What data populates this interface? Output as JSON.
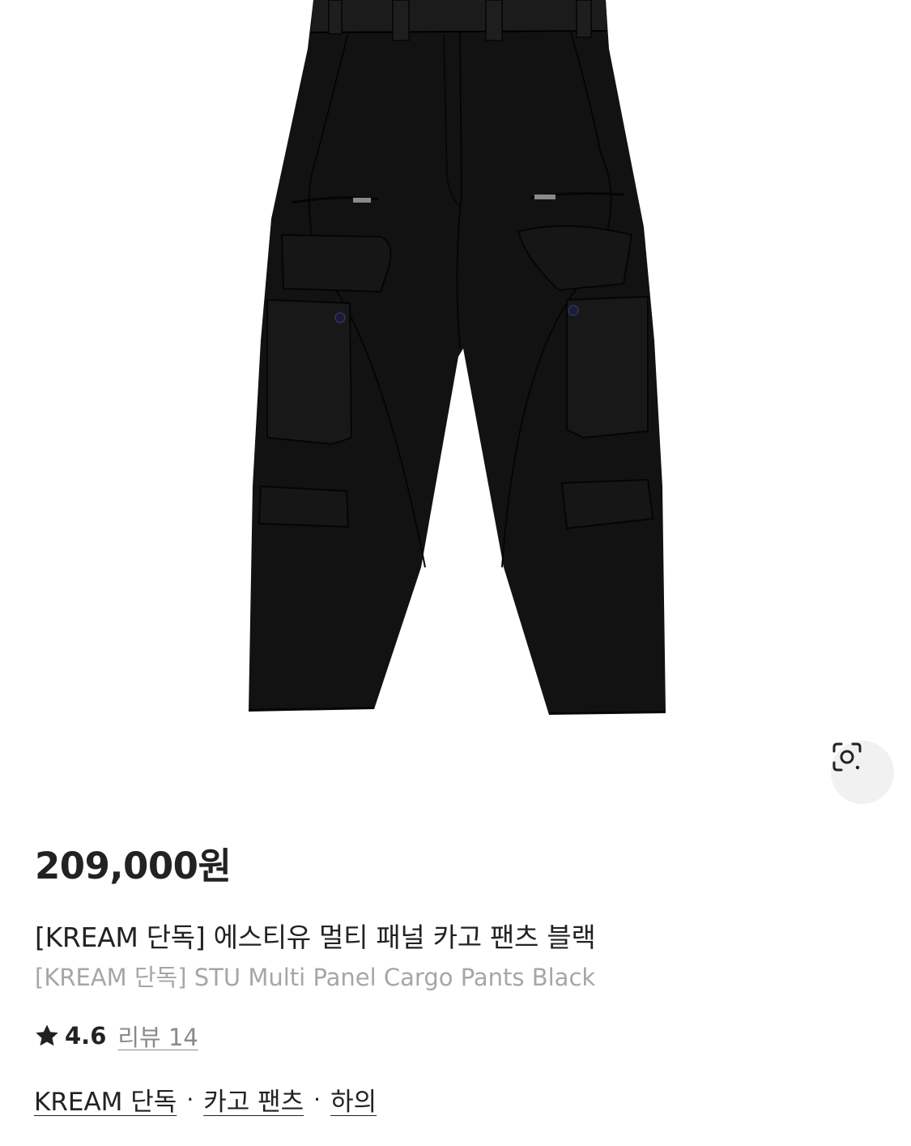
{
  "product": {
    "image_alt": "black multi panel cargo pants",
    "price": "209,000원",
    "title_ko": "[KREAM 단독] 에스티유 멀티 패널 카고 팬츠 블랙",
    "title_en": "[KREAM 단독] STU Multi Panel Cargo Pants Black"
  },
  "rating": {
    "icon": "star-icon",
    "value": "4.6",
    "review_link": "리뷰 14"
  },
  "lens_button": {
    "icon": "lens-search-icon"
  },
  "categories": {
    "items": [
      "KREAM 단독",
      "카고 팬츠",
      "하의"
    ],
    "separator": "·"
  }
}
